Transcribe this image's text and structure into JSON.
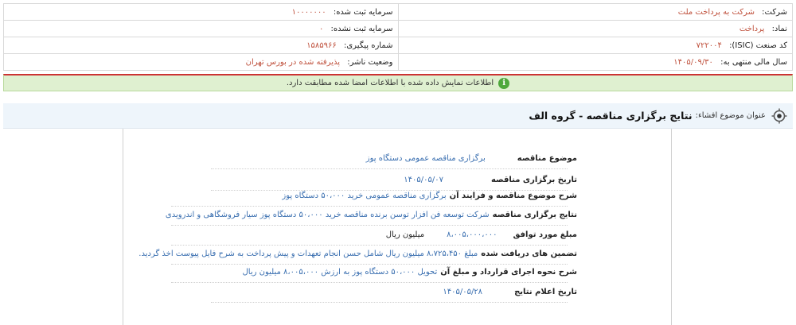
{
  "company_info": {
    "company_label": "شرکت:",
    "company_value": "شرکت به پرداخت ملت",
    "registered_capital_label": "سرمایه ثبت شده:",
    "registered_capital_value": "۱۰۰۰۰۰۰۰",
    "symbol_label": "نماد:",
    "symbol_value": "پرداخت",
    "unregistered_capital_label": "سرمایه ثبت نشده:",
    "unregistered_capital_value": "۰",
    "isic_label": "کد صنعت (ISIC):",
    "isic_value": "۷۲۲۰۰۴",
    "tracking_label": "شماره پیگیری:",
    "tracking_value": "۱۵۸۵۹۶۶",
    "fiscal_year_label": "سال مالی منتهی به:",
    "fiscal_year_value": "۱۴۰۵/۰۹/۳۰",
    "publisher_status_label": "وضعیت ناشر:",
    "publisher_status_value": "پذیرفته شده در بورس تهران"
  },
  "notice": {
    "icon_text": "i",
    "text": "اطلاعات نمایش داده شده با اطلاعات امضا شده مطابقت دارد."
  },
  "subject": {
    "label": "عنوان موضوع افشاء:",
    "title": "نتایج برگزاری مناقصه - گروه الف"
  },
  "details": [
    {
      "label": "موضوع مناقصه",
      "value": "برگزاری مناقصه عمومی دستگاه پوز",
      "unit": ""
    },
    {
      "label": "تاریخ برگزاری مناقصه",
      "value": "۱۴۰۵/۰۵/۰۷",
      "unit": ""
    },
    {
      "label": "شرح موضوع مناقصه و فرایند آن",
      "value": "برگزاری مناقصه عمومی خرید ۵۰،۰۰۰ دستگاه پوز",
      "unit": ""
    },
    {
      "label": "نتایج برگزاری مناقصه",
      "value": "شرکت توسعه فن افزار توسن برنده مناقصه خرید ۵۰،۰۰۰ دستگاه پوز سیار فروشگاهی و اندرویدی",
      "unit": ""
    },
    {
      "label": "مبلغ مورد توافق",
      "value": "۸،۰۰۵،۰۰۰،۰۰۰",
      "unit": "میلیون ریال"
    },
    {
      "label": "تضمین های دریافت شده",
      "value": "مبلغ ۸،۷۲۵،۴۵۰ میلیون ریال شامل حسن انجام تعهدات و پیش پرداخت به شرح فایل پیوست اخذ گردید.",
      "unit": ""
    },
    {
      "label": "شرح نحوه اجرای قرارداد و مبلغ آن",
      "value": "تحویل ۵۰،۰۰۰ دستگاه پوز به ارزش ۸،۰۰۵،۰۰۰ میلیون ریال",
      "unit": ""
    },
    {
      "label": "تاریخ اعلام نتایج",
      "value": "۱۴۰۵/۰۵/۲۸",
      "unit": ""
    }
  ]
}
